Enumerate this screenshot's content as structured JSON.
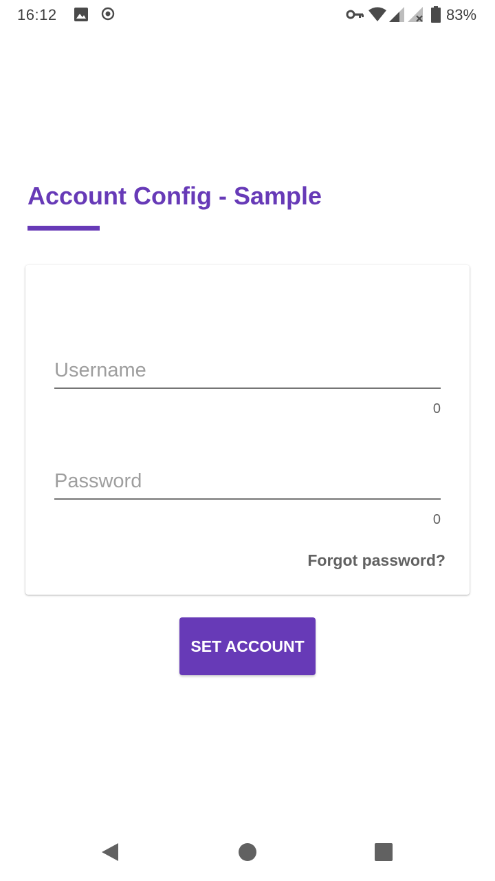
{
  "status_bar": {
    "time": "16:12",
    "battery_percent": "83%",
    "icons": [
      "image-icon",
      "record-icon",
      "vpn-key-icon",
      "wifi-icon",
      "signal-icon",
      "signal-no-service-icon",
      "battery-icon"
    ]
  },
  "page": {
    "title": "Account Config - Sample",
    "accent_color": "#673ab7"
  },
  "form": {
    "username": {
      "value": "",
      "placeholder": "Username",
      "counter": "0"
    },
    "password": {
      "value": "",
      "placeholder": "Password",
      "counter": "0"
    },
    "forgot_label": "Forgot password?"
  },
  "actions": {
    "set_account_label": "SET ACCOUNT"
  },
  "nav_bar": {
    "icons": [
      "back-icon",
      "home-icon",
      "recents-icon"
    ]
  }
}
